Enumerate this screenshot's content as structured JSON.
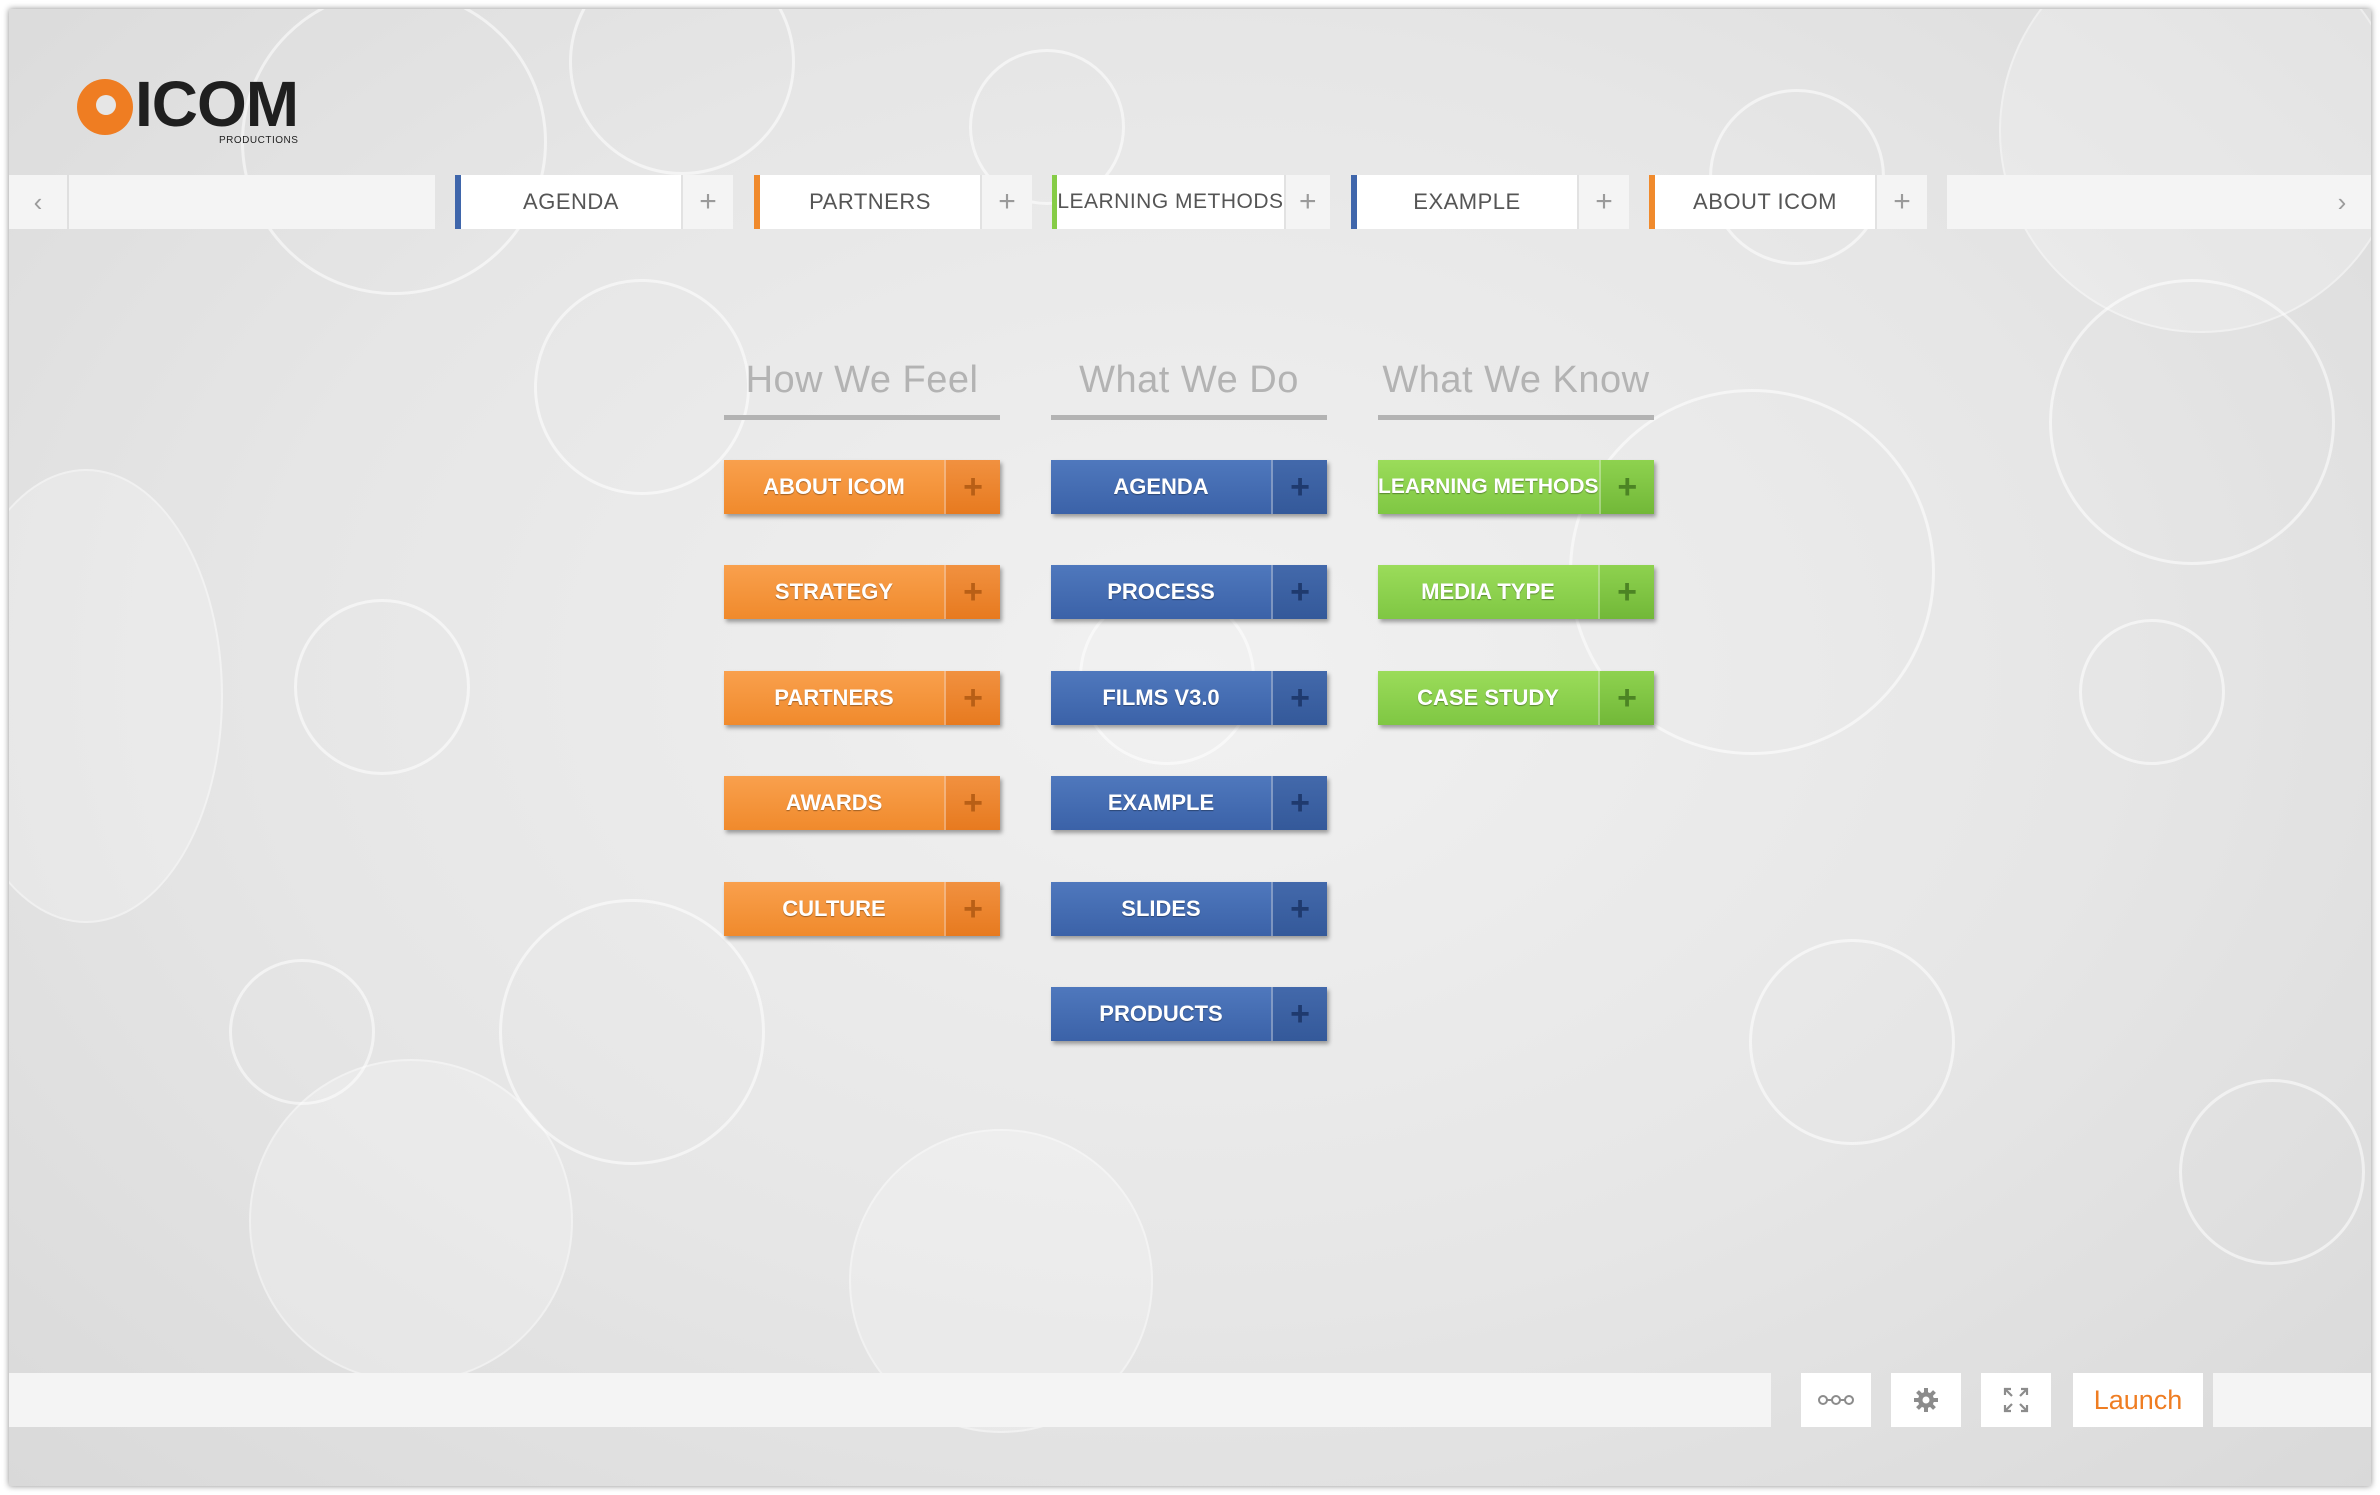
{
  "app": {
    "brand": "ICOM",
    "brand_sub": "PRODUCTIONS"
  },
  "colors": {
    "orange": "#f08a2c",
    "blue": "#3f66ab",
    "green": "#86cc46",
    "accent": "#ef7d22"
  },
  "tabbar": {
    "prev_icon": "chevron-left-icon",
    "next_icon": "chevron-right-icon",
    "tabs": [
      {
        "label": "AGENDA",
        "color": "#3f66ab",
        "icon": "plus-icon"
      },
      {
        "label": "PARTNERS",
        "color": "#f08a2c",
        "icon": "plus-icon"
      },
      {
        "label": "LEARNING METHODS",
        "color": "#86cc46",
        "icon": "plus-icon"
      },
      {
        "label": "EXAMPLE",
        "color": "#3f66ab",
        "icon": "plus-icon"
      },
      {
        "label": "ABOUT ICOM",
        "color": "#f08a2c",
        "icon": "plus-icon"
      }
    ]
  },
  "columns": [
    {
      "title": "How We Feel",
      "color": "orange",
      "items": [
        "ABOUT ICOM",
        "STRATEGY",
        "PARTNERS",
        "AWARDS",
        "CULTURE"
      ]
    },
    {
      "title": "What We Do",
      "color": "blue",
      "items": [
        "AGENDA",
        "PROCESS",
        "FILMS V3.0",
        "EXAMPLE",
        "SLIDES",
        "PRODUCTS"
      ]
    },
    {
      "title": "What We Know",
      "color": "green",
      "items": [
        "LEARNING METHODS",
        "MEDIA TYPE",
        "CASE STUDY"
      ]
    }
  ],
  "bottombar": {
    "tools": [
      "link-icon",
      "gear-icon",
      "fullscreen-icon"
    ],
    "launch_label": "Launch"
  }
}
